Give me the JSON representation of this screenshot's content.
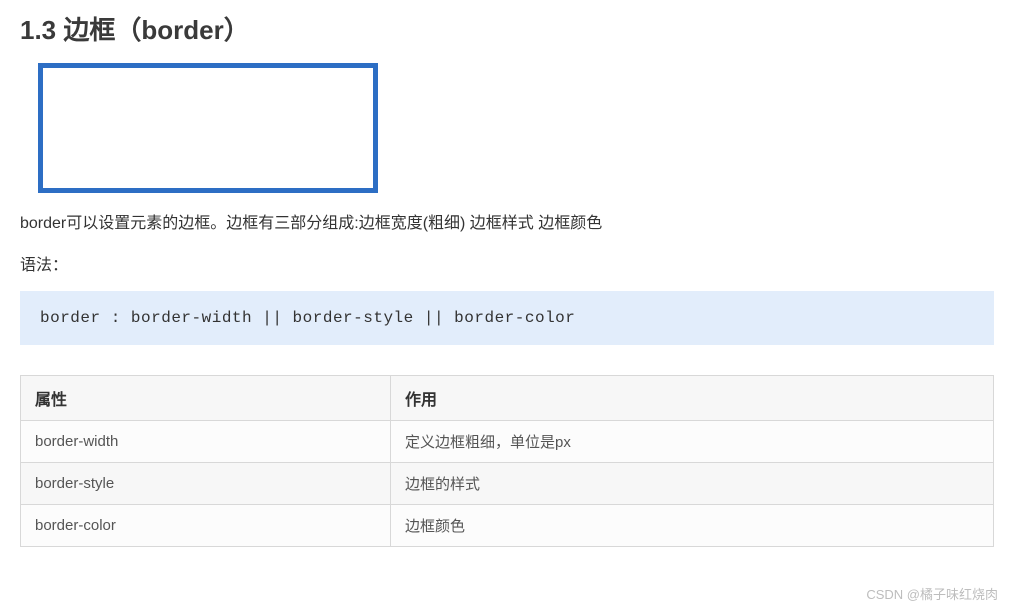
{
  "heading": "1.3 边框（border）",
  "description": "border可以设置元素的边框。边框有三部分组成:边框宽度(粗细) 边框样式 边框颜色",
  "syntax_label": "语法：",
  "code": "border : border-width || border-style || border-color",
  "table": {
    "headers": [
      "属性",
      "作用"
    ],
    "rows": [
      {
        "prop": "border-width",
        "desc": "定义边框粗细，单位是px"
      },
      {
        "prop": "border-style",
        "desc": "边框的样式"
      },
      {
        "prop": "border-color",
        "desc": "边框颜色"
      }
    ]
  },
  "watermark": "CSDN @橘子味红烧肉",
  "cursor_glyph": "↖"
}
